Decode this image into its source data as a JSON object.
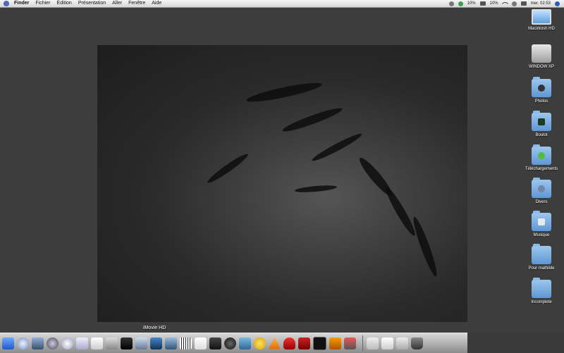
{
  "menubar": {
    "items": [
      "Finder",
      "Fichier",
      "Édition",
      "Présentation",
      "Aller",
      "Fenêtre",
      "Aide"
    ],
    "status": {
      "battery1": "10%",
      "battery2": "10%",
      "clock": "mer. 02:53"
    }
  },
  "desktop_icons": [
    {
      "label": "Macintosh HD",
      "icon": "monitor-icon"
    },
    {
      "label": "WINDOW XP",
      "icon": "hard-drive-icon"
    },
    {
      "label": "Photos",
      "icon": "folder-photos-icon"
    },
    {
      "label": "Boulot",
      "icon": "folder-boulot-icon"
    },
    {
      "label": "Téléchargements",
      "icon": "folder-downloads-icon"
    },
    {
      "label": "Divers",
      "icon": "folder-divers-icon"
    },
    {
      "label": "Musique",
      "icon": "folder-music-icon"
    },
    {
      "label": "Pour mathilde",
      "icon": "folder-icon"
    },
    {
      "label": "Incomplete",
      "icon": "folder-icon"
    }
  ],
  "dock": {
    "hover_label": "iMovie HD",
    "items": [
      "finder-icon",
      "safari-icon",
      "ichat-icon",
      "quicktime-icon",
      "itunes-icon",
      "mail-icon",
      "textedit-icon",
      "iphoto-icon",
      "imovie-icon",
      "preview-icon",
      "photo-booth-icon",
      "xcode-icon",
      "piano-icon",
      "ical-icon",
      "clapboard-icon",
      "camera-icon",
      "iweb-icon",
      "duck-icon",
      "vlc-icon",
      "magnet-icon",
      "red-app-icon",
      "terminal-icon",
      "garageband-icon",
      "chart-app-icon"
    ],
    "right_items": [
      "network-icon",
      "documents-icon",
      "downloads-icon",
      "trash-icon"
    ]
  }
}
